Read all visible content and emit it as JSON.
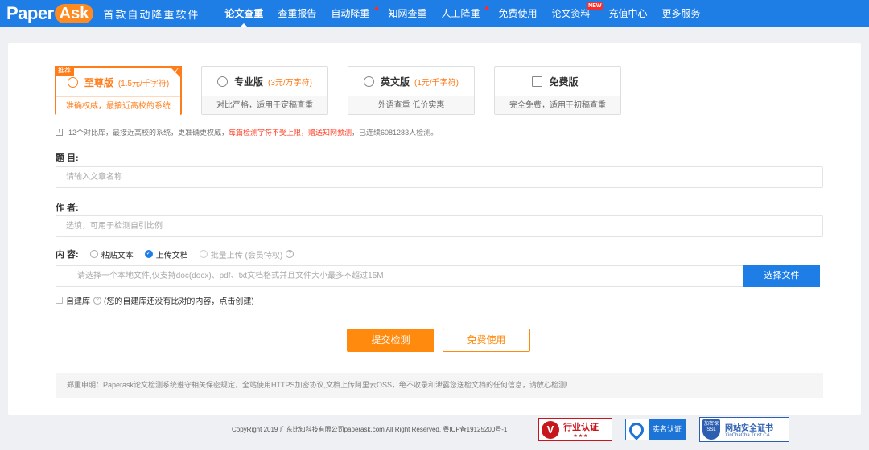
{
  "brand": {
    "logo_text": "Paper",
    "logo_badge": "Ask",
    "slogan": "首款自动降重软件",
    "primary_color": "#1f7ee6",
    "accent_color": "#ff8a0d"
  },
  "nav": {
    "items": [
      {
        "label": "论文查重",
        "active": true
      },
      {
        "label": "查重报告"
      },
      {
        "label": "自动降重",
        "hot": true
      },
      {
        "label": "知网查重"
      },
      {
        "label": "人工降重",
        "hot": true
      },
      {
        "label": "免费使用"
      },
      {
        "label": "论文资料",
        "badge": "NEW"
      },
      {
        "label": "充值中心"
      },
      {
        "label": "更多服务"
      }
    ],
    "hot_icon": "flame-icon",
    "new_badge": "NEW"
  },
  "versions": [
    {
      "tag": "推荐",
      "icon": "crossed-circle-icon",
      "name": "至尊版",
      "price": "(1.5元/千字符)",
      "desc": "准确权威，最接近高校的系统",
      "selected": true
    },
    {
      "icon": "compass-icon",
      "name": "专业版",
      "price": "(3元/万字符)",
      "desc": "对比严格，适用于定稿查重"
    },
    {
      "icon": "target-icon",
      "name": "英文版",
      "price": "(1元/千字符)",
      "desc": "外语查重 低价实惠"
    },
    {
      "icon": "book-icon",
      "name": "免费版",
      "price": "",
      "desc": "完全免费，适用于初稿查重"
    }
  ],
  "notice": {
    "part1": "12个对比库，最接近高校的系统，更准确更权威，",
    "part2": "每篇检测字符不受上限，赠送知网预测",
    "part3": "，已连续6081283人检测。"
  },
  "form": {
    "title_label": "题 目:",
    "title_placeholder": "请输入文章名称",
    "author_label": "作 者:",
    "author_placeholder": "选填，可用于检测自引比例",
    "content_label": "内 容:",
    "radio_paste": "粘贴文本",
    "radio_upload": "上传文档",
    "radio_batch": "批量上传 (会员特权)",
    "file_placeholder": "请选择一个本地文件,仅支持doc(docx)、pdf、txt文档格式并且文件大小最多不超过15M",
    "file_button": "选择文件",
    "selfdb_label": "自建库",
    "selfdb_hint": "(您的自建库还没有比对的内容，点击创建)",
    "submit_button": "提交检测",
    "free_button": "免费使用"
  },
  "statement": "郑重申明：Paperask论文检测系统遵守相关保密规定，全站使用HTTPS加密协议,文档上传阿里云OSS，绝不收录和泄露您送检文档的任何信息，请放心检测!",
  "footer": {
    "copyright": "CopyRight 2019 广东比知科技有限公司paperask.com All Right Reserved. 粤ICP备19125200号-1",
    "industry_badge": "行业认证",
    "industry_stars": "★★★",
    "realname_badge": "实名认证",
    "ssl_title": "网站安全证书",
    "ssl_sub": "XinChaCha Trust CA",
    "ssl_shield": "加密保 SSL"
  }
}
